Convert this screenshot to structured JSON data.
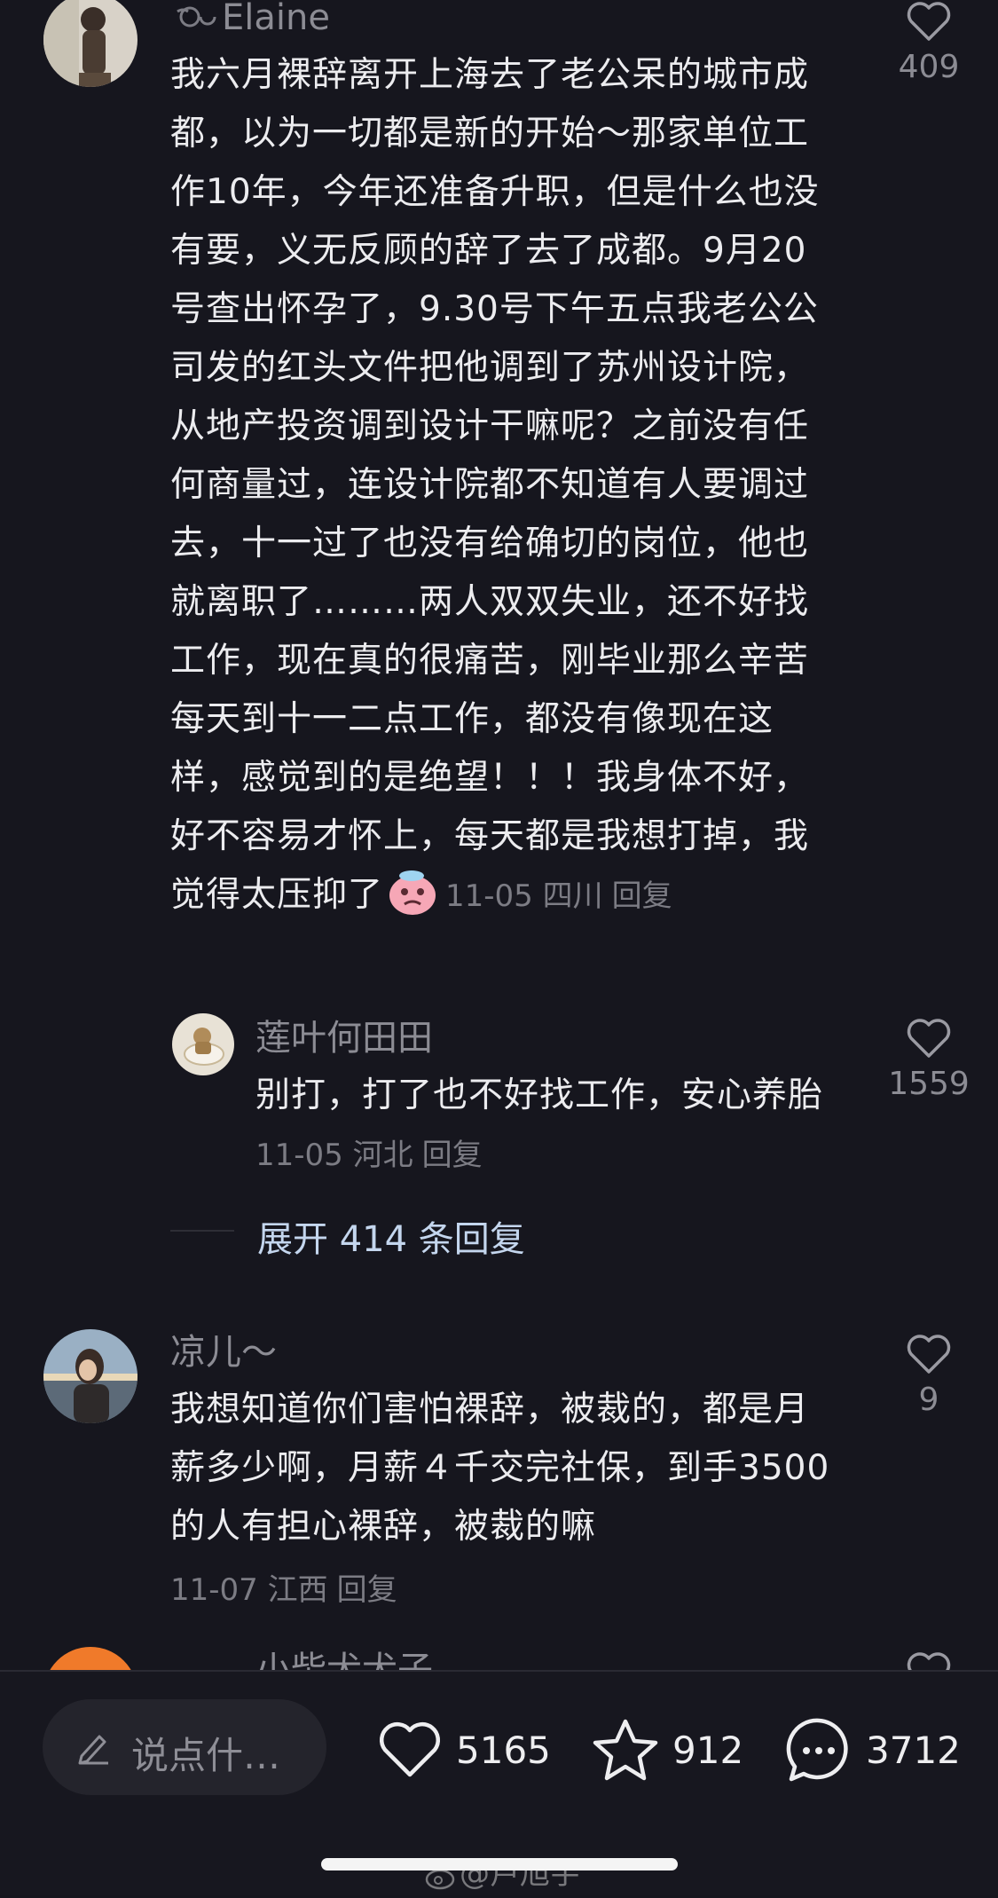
{
  "comments": [
    {
      "user": "Elaine",
      "text": "我六月裸辞离开上海去了老公呆的城市成都，以为一切都是新的开始～那家单位工作10年，今年还准备升职，但是什么也没有要，义无反顾的辞了去了成都。9月20号查出怀孕了，9.30号下午五点我老公公司发的红头文件把他调到了苏州设计院，从地产投资调到设计干嘛呢？之前没有任何商量过，连设计院都不知道有人要调过去，十一过了也没有给确切的岗位，他也就离职了………两人双双失业，还不好找工作，现在真的很痛苦，刚毕业那么辛苦每天到十一二点工作，都没有像现在这样，感觉到的是绝望！！！我身体不好，好不容易才怀上，每天都是我想打掉，我觉得太压抑了",
      "date_loc": "11-05 四川",
      "reply_label": "回复",
      "likes": "409"
    },
    {
      "user": "莲叶何田田",
      "text": "别打，打了也不好找工作，安心养胎",
      "date_loc": "11-05 河北",
      "reply_label": "回复",
      "likes": "1559"
    },
    {
      "user": "凉儿～",
      "text": "我想知道你们害怕裸辞，被裁的，都是月薪多少啊，月薪４千交完社保，到手3500的人有担心裸辞，被裁的嘛",
      "date_loc": "11-07 江西",
      "reply_label": "回复",
      "likes": "9"
    },
    {
      "user": "小柴犬犬子"
    }
  ],
  "expand_replies": "展开 414 条回复",
  "bottom_bar": {
    "input_placeholder": "说点什…",
    "likes": "5165",
    "favorites": "912",
    "comments": "3712"
  },
  "watermark": "@卢旭宇",
  "colors": {
    "background": "#16161e",
    "link": "#c4d6ee",
    "muted": "#8c8c94"
  }
}
